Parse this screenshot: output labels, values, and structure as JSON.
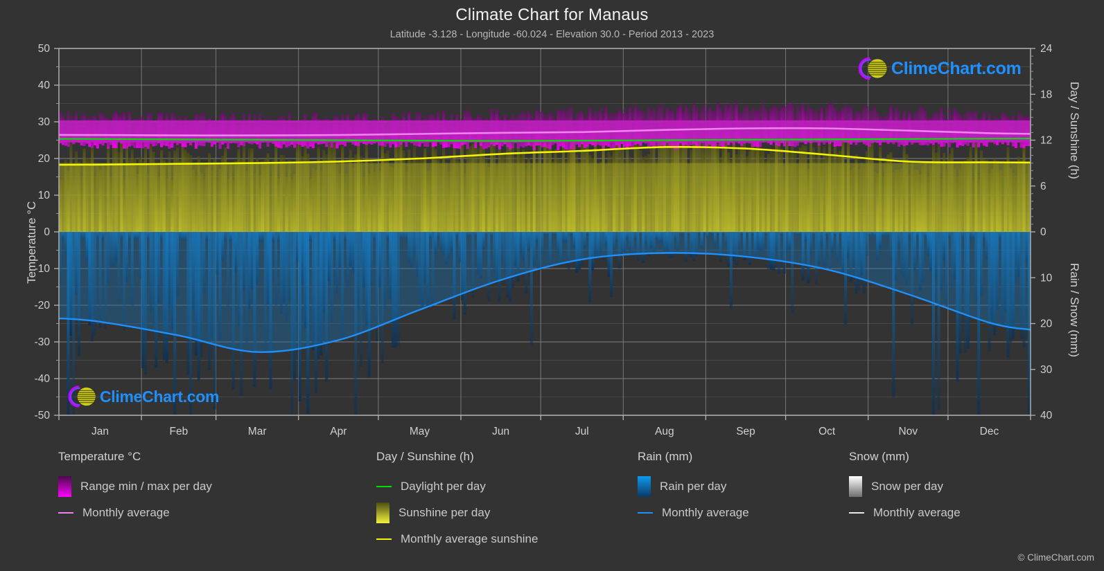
{
  "header": {
    "title": "Climate Chart for Manaus",
    "subtitle": "Latitude -3.128 - Longitude -60.024 - Elevation 30.0 - Period 2013 - 2023"
  },
  "axes": {
    "left_title": "Temperature °C",
    "right_top_title": "Day / Sunshine (h)",
    "right_bottom_title": "Rain / Snow (mm)"
  },
  "watermark": {
    "text": "ClimeChart.com",
    "arc_color": "#cc00ff",
    "sphere_color": "#d4d400",
    "text_color": "#1e90ff"
  },
  "footer": {
    "copyright": "© ClimeChart.com"
  },
  "legend": {
    "groups": [
      {
        "title": "Temperature °C",
        "items": [
          {
            "label": "Range min / max per day",
            "marker": "gradient",
            "color_top": "#4a0a4a",
            "color_bottom": "#ff00ff"
          },
          {
            "label": "Monthly average",
            "marker": "line",
            "color": "#ee82ee"
          }
        ]
      },
      {
        "title": "Day / Sunshine (h)",
        "items": [
          {
            "label": "Daylight per day",
            "marker": "line",
            "color": "#00e000"
          },
          {
            "label": "Sunshine per day",
            "marker": "gradient",
            "color_top": "#4d4d12",
            "color_bottom": "#f2f23d"
          },
          {
            "label": "Monthly average sunshine",
            "marker": "line",
            "color": "#f5f500"
          }
        ]
      },
      {
        "title": "Rain (mm)",
        "items": [
          {
            "label": "Rain per day",
            "marker": "gradient",
            "color_top": "#0d99f0",
            "color_bottom": "#0b3a63"
          },
          {
            "label": "Monthly average",
            "marker": "line",
            "color": "#1e90ff"
          }
        ]
      },
      {
        "title": "Snow (mm)",
        "items": [
          {
            "label": "Snow per day",
            "marker": "gradient",
            "color_top": "#ffffff",
            "color_bottom": "#6e6e6e"
          },
          {
            "label": "Monthly average",
            "marker": "line",
            "color": "#e8e8e8"
          }
        ]
      }
    ]
  },
  "chart_data": {
    "type": "area",
    "title": "Climate Chart for Manaus",
    "subtitle": "Latitude -3.128 - Longitude -60.024 - Elevation 30.0 - Period 2013 - 2023",
    "xlabel": "",
    "ylabel": "Temperature °C",
    "grid": true,
    "legend_position": "bottom",
    "categories": [
      "Jan",
      "Feb",
      "Mar",
      "Apr",
      "May",
      "Jun",
      "Jul",
      "Aug",
      "Sep",
      "Oct",
      "Nov",
      "Dec"
    ],
    "x_tick_labels": [
      "Jan",
      "Feb",
      "Mar",
      "Apr",
      "May",
      "Jun",
      "Jul",
      "Aug",
      "Sep",
      "Oct",
      "Nov",
      "Dec"
    ],
    "axis_left": {
      "label": "Temperature °C",
      "ylim": [
        -50,
        50
      ],
      "ticks": [
        50,
        40,
        30,
        20,
        10,
        0,
        -10,
        -20,
        -30,
        -40,
        -50
      ],
      "minor_step": 5
    },
    "axis_right_top": {
      "label": "Day / Sunshine (h)",
      "ylim": [
        0,
        24
      ],
      "ticks": [
        24,
        18,
        12,
        6,
        0
      ],
      "maps_to_temperature": [
        0,
        50
      ]
    },
    "axis_right_bottom": {
      "label": "Rain / Snow (mm)",
      "ylim": [
        0,
        40
      ],
      "ticks": [
        0,
        10,
        20,
        30,
        40
      ],
      "maps_to_temperature": [
        0,
        -50
      ]
    },
    "series": [
      {
        "name": "Monthly average temperature",
        "unit": "°C",
        "axis": "left",
        "color": "#ee82ee",
        "values": [
          26.4,
          26.3,
          26.3,
          26.4,
          26.7,
          27.0,
          27.2,
          27.8,
          28.2,
          28.2,
          27.6,
          26.9
        ]
      },
      {
        "name": "Range max per day (daily high envelope)",
        "unit": "°C",
        "axis": "left",
        "color": "#ff00ff",
        "values": [
          31.0,
          30.8,
          30.7,
          30.9,
          31.3,
          31.8,
          32.2,
          33.2,
          33.6,
          33.4,
          32.6,
          31.6
        ]
      },
      {
        "name": "Range min per day (daily low envelope)",
        "unit": "°C",
        "axis": "left",
        "color": "#ff00ff",
        "values": [
          23.6,
          23.6,
          23.6,
          23.7,
          23.8,
          23.4,
          23.1,
          23.4,
          23.9,
          24.2,
          24.1,
          23.9
        ]
      },
      {
        "name": "Daylight per day",
        "unit": "h",
        "axis": "right_top",
        "color": "#00e000",
        "values": [
          12.15,
          12.1,
          12.05,
          12.0,
          11.95,
          11.9,
          11.95,
          12.0,
          12.05,
          12.1,
          12.15,
          12.2
        ]
      },
      {
        "name": "Monthly average sunshine",
        "unit": "h",
        "axis": "right_top",
        "color": "#f5f500",
        "values": [
          8.8,
          8.9,
          9.0,
          9.2,
          9.6,
          10.2,
          10.6,
          11.1,
          10.9,
          10.1,
          9.2,
          9.1
        ]
      },
      {
        "name": "Monthly average rain",
        "unit": "mm",
        "axis": "right_bottom",
        "color": "#1e90ff",
        "values": [
          19.6,
          22.6,
          26.2,
          23.6,
          17.0,
          10.5,
          6.0,
          4.6,
          5.4,
          8.2,
          13.6,
          19.8
        ]
      }
    ],
    "notes": "Dense daily bars: magenta daily temperature min/max range, olive/yellow daily sunshine hours (from 0 upward on right-top axis), blue daily rainfall (from 0 downward on right-bottom axis). No snow present."
  }
}
